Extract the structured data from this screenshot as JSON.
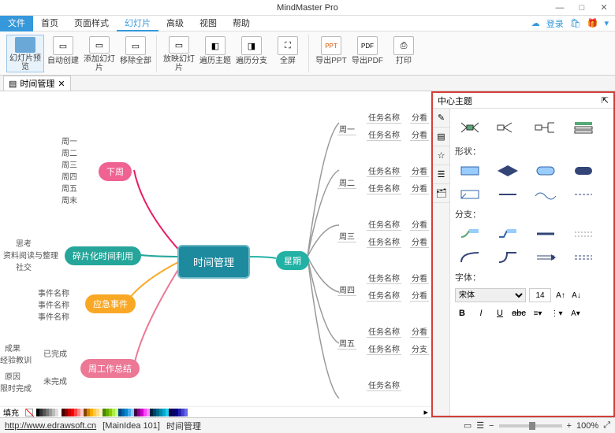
{
  "window": {
    "title": "MindMaster Pro",
    "min": "—",
    "max": "□",
    "close": "✕"
  },
  "menu": {
    "file": "文件",
    "items": [
      "首页",
      "页面样式",
      "幻灯片",
      "高级",
      "视图",
      "帮助"
    ],
    "activeIndex": 2,
    "login": "登录"
  },
  "ribbon": {
    "g1": [
      {
        "id": "preview",
        "label": "幻灯片预览"
      },
      {
        "id": "autocreate",
        "label": "自动创建"
      },
      {
        "id": "addslide",
        "label": "添加幻灯片"
      },
      {
        "id": "removeall",
        "label": "移除全部"
      }
    ],
    "g2": [
      {
        "id": "play",
        "label": "放映幻灯片"
      },
      {
        "id": "traverse",
        "label": "遍历主题"
      },
      {
        "id": "branch",
        "label": "遍历分支"
      },
      {
        "id": "fullscreen",
        "label": "全屏"
      }
    ],
    "g3": [
      {
        "id": "exportppt",
        "label": "导出PPT"
      },
      {
        "id": "exportpdf",
        "label": "导出PDF"
      },
      {
        "id": "print",
        "label": "打印"
      }
    ]
  },
  "doctab": {
    "name": "时间管理",
    "close": "✕"
  },
  "mindmap": {
    "center": "时间管理",
    "weekNode": "星期",
    "pink": "下周",
    "teal": "碎片化时间利用",
    "yellow": "应急事件",
    "rose": "周工作总结",
    "days": [
      "周一",
      "周二",
      "周三",
      "周四",
      "周五",
      "周末"
    ],
    "dayShort": [
      "周一",
      "周二",
      "周三",
      "周四",
      "周五"
    ],
    "frag": [
      "思考",
      "资料阅读与整理",
      "社交"
    ],
    "emerg": [
      "事件名称",
      "事件名称",
      "事件名称"
    ],
    "summary_done": "已完成",
    "summary_undone": "未完成",
    "done_items": [
      "成果",
      "经验教训"
    ],
    "undone_items": [
      "原因",
      "限时完成"
    ],
    "task": "任务名称",
    "cat": "分看",
    "lastcat": "分支"
  },
  "panel": {
    "title": "中心主题",
    "shape": "形状：",
    "branch": "分支：",
    "font": "字体：",
    "fontname": "宋体",
    "fontsize": "14"
  },
  "palette": {
    "label": "填充"
  },
  "status": {
    "url": "http://www.edrawsoft.cn",
    "doc": "[MainIdea 101]",
    "name": "时间管理",
    "zoom": "100%"
  },
  "colors": {
    "swatches": [
      "#000",
      "#333",
      "#555",
      "#777",
      "#999",
      "#bbb",
      "#ddd",
      "#fff",
      "#400",
      "#800",
      "#c00",
      "#f00",
      "#f44",
      "#f88",
      "#fcc",
      "#840",
      "#c80",
      "#fa0",
      "#fc4",
      "#fd8",
      "#fec",
      "#480",
      "#6a0",
      "#8c0",
      "#ae4",
      "#cf8",
      "#048",
      "#06a",
      "#08c",
      "#4ae",
      "#8cf",
      "#404",
      "#808",
      "#c0c",
      "#f4f",
      "#f8f",
      "#024",
      "#046",
      "#068",
      "#08a",
      "#0ac",
      "#2ce",
      "#004",
      "#006",
      "#008",
      "#22a",
      "#44c",
      "#66e"
    ]
  }
}
